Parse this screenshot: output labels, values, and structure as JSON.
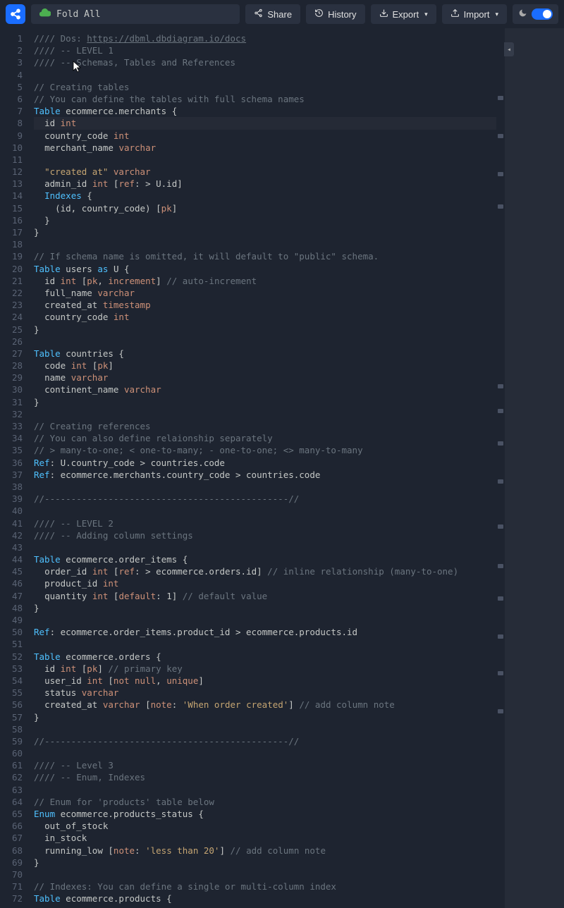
{
  "toolbar": {
    "save_label": "Fold All",
    "share_label": "Share",
    "history_label": "History",
    "export_label": "Export",
    "import_label": "Import"
  },
  "doc_url": "https://dbml.dbdiagram.io/docs",
  "lines": [
    {
      "t": "comment",
      "pre": "//// Do",
      "mid": "s: ",
      "link": "https://dbml.dbdiagram.io/docs"
    },
    {
      "t": "comment",
      "text": "//// -- LEVEL 1"
    },
    {
      "t": "comment",
      "text": "//// -- Schemas, Tables and References"
    },
    {
      "t": "blank"
    },
    {
      "t": "comment",
      "text": "// Creating tables"
    },
    {
      "t": "comment",
      "text": "// You can define the tables with full schema names"
    },
    {
      "t": "table",
      "kw": "Table",
      "name": "ecommerce.merchants",
      "brace": " {"
    },
    {
      "t": "field",
      "indent": 1,
      "name": "id",
      "type": "int"
    },
    {
      "t": "field",
      "indent": 1,
      "name": "country_code",
      "type": "int"
    },
    {
      "t": "field",
      "indent": 1,
      "name": "merchant_name",
      "type": "varchar"
    },
    {
      "t": "blank"
    },
    {
      "t": "field",
      "indent": 1,
      "name": "\"created at\"",
      "type": "varchar",
      "nameIsString": true
    },
    {
      "t": "field_ref",
      "indent": 1,
      "name": "admin_id",
      "type": "int",
      "bracket": "[",
      "refkw": "ref",
      "rest": ": > U.id]"
    },
    {
      "t": "indexes",
      "indent": 1,
      "kw": "Indexes",
      "brace": " {"
    },
    {
      "t": "index_row",
      "indent": 2,
      "text": "(id, country_code) [",
      "pk": "pk",
      "end": "]"
    },
    {
      "t": "close",
      "indent": 1,
      "brace": "}"
    },
    {
      "t": "close",
      "indent": 0,
      "brace": "}"
    },
    {
      "t": "blank"
    },
    {
      "t": "comment",
      "text": "// If schema name is omitted, it will default to \"public\" schema."
    },
    {
      "t": "table_as",
      "kw": "Table",
      "name": "users",
      "as": "as",
      "alias": "U",
      "brace": " {"
    },
    {
      "t": "field_attrs",
      "indent": 1,
      "name": "id",
      "type": "int",
      "bracket": "[",
      "attrs": "pk, increment",
      "end": "]",
      "cmt": " // auto-increment"
    },
    {
      "t": "field",
      "indent": 1,
      "name": "full_name",
      "type": "varchar"
    },
    {
      "t": "field",
      "indent": 1,
      "name": "created_at",
      "type": "timestamp"
    },
    {
      "t": "field",
      "indent": 1,
      "name": "country_code",
      "type": "int"
    },
    {
      "t": "close",
      "indent": 0,
      "brace": "}"
    },
    {
      "t": "blank"
    },
    {
      "t": "table",
      "kw": "Table",
      "name": "countries",
      "brace": " {"
    },
    {
      "t": "field_attrs",
      "indent": 1,
      "name": "code",
      "type": "int",
      "bracket": "[",
      "attrs": "pk",
      "end": "]"
    },
    {
      "t": "field",
      "indent": 1,
      "name": "name",
      "type": "varchar"
    },
    {
      "t": "field",
      "indent": 1,
      "name": "continent_name",
      "type": "varchar"
    },
    {
      "t": "close",
      "indent": 0,
      "brace": "}"
    },
    {
      "t": "blank"
    },
    {
      "t": "comment",
      "text": "// Creating references"
    },
    {
      "t": "comment",
      "text": "// You can also define relaionship separately"
    },
    {
      "t": "comment",
      "text": "// > many-to-one; < one-to-many; - one-to-one; <> many-to-many"
    },
    {
      "t": "ref",
      "kw": "Ref",
      "rest": ": U.country_code > countries.code"
    },
    {
      "t": "ref",
      "kw": "Ref",
      "rest": ": ecommerce.merchants.country_code > countries.code"
    },
    {
      "t": "blank"
    },
    {
      "t": "comment",
      "text": "//----------------------------------------------//"
    },
    {
      "t": "blank"
    },
    {
      "t": "comment",
      "text": "//// -- LEVEL 2"
    },
    {
      "t": "comment",
      "text": "//// -- Adding column settings"
    },
    {
      "t": "blank"
    },
    {
      "t": "table",
      "kw": "Table",
      "name": "ecommerce.order_items",
      "brace": " {"
    },
    {
      "t": "field_ref",
      "indent": 1,
      "name": "order_id",
      "type": "int",
      "bracket": "[",
      "refkw": "ref",
      "rest": ": > ecommerce.orders.id]",
      "cmt": " // inline relationship (many-to-one)"
    },
    {
      "t": "field",
      "indent": 1,
      "name": "product_id",
      "type": "int"
    },
    {
      "t": "field_default",
      "indent": 1,
      "name": "quantity",
      "type": "int",
      "bracket": "[",
      "defkw": "default",
      "rest": ": 1]",
      "cmt": " // default value"
    },
    {
      "t": "close",
      "indent": 0,
      "brace": "}"
    },
    {
      "t": "blank"
    },
    {
      "t": "ref",
      "kw": "Ref",
      "rest": ": ecommerce.order_items.product_id > ecommerce.products.id"
    },
    {
      "t": "blank"
    },
    {
      "t": "table",
      "kw": "Table",
      "name": "ecommerce.orders",
      "brace": " {"
    },
    {
      "t": "field_attrs",
      "indent": 1,
      "name": "id",
      "type": "int",
      "bracket": "[",
      "attrs": "pk",
      "end": "]",
      "cmt": " // primary key"
    },
    {
      "t": "field_attrs",
      "indent": 1,
      "name": "user_id",
      "type": "int",
      "bracket": "[",
      "attrs": "not null, unique",
      "end": "]",
      "attrMixed": true
    },
    {
      "t": "field",
      "indent": 1,
      "name": "status",
      "type": "varchar"
    },
    {
      "t": "field_note",
      "indent": 1,
      "name": "created_at",
      "type": "varchar",
      "bracket": "[",
      "notekw": "note",
      "colon": ": ",
      "str": "'When order created'",
      "end": "]",
      "cmt": " // add column note"
    },
    {
      "t": "close",
      "indent": 0,
      "brace": "}"
    },
    {
      "t": "blank"
    },
    {
      "t": "comment",
      "text": "//----------------------------------------------//"
    },
    {
      "t": "blank"
    },
    {
      "t": "comment",
      "text": "//// -- Level 3"
    },
    {
      "t": "comment",
      "text": "//// -- Enum, Indexes"
    },
    {
      "t": "blank"
    },
    {
      "t": "comment",
      "text": "// Enum for 'products' table below"
    },
    {
      "t": "enum",
      "kw": "Enum",
      "name": "ecommerce.products_status",
      "brace": " {"
    },
    {
      "t": "enum_val",
      "indent": 1,
      "name": "out_of_stock"
    },
    {
      "t": "enum_val",
      "indent": 1,
      "name": "in_stock"
    },
    {
      "t": "enum_note",
      "indent": 1,
      "name": "running_low",
      "bracket": "[",
      "notekw": "note",
      "colon": ": ",
      "str": "'less than 20'",
      "end": "]",
      "cmt": " // add column note"
    },
    {
      "t": "close",
      "indent": 0,
      "brace": "}"
    },
    {
      "t": "blank"
    },
    {
      "t": "comment",
      "text": "// Indexes: You can define a single or multi-column index"
    },
    {
      "t": "table",
      "kw": "Table",
      "name": "ecommerce.products",
      "brace": " {"
    }
  ],
  "minimap_marks": [
    96,
    150,
    204,
    250,
    505,
    540,
    586,
    640,
    704,
    760,
    806,
    860,
    912,
    966
  ]
}
